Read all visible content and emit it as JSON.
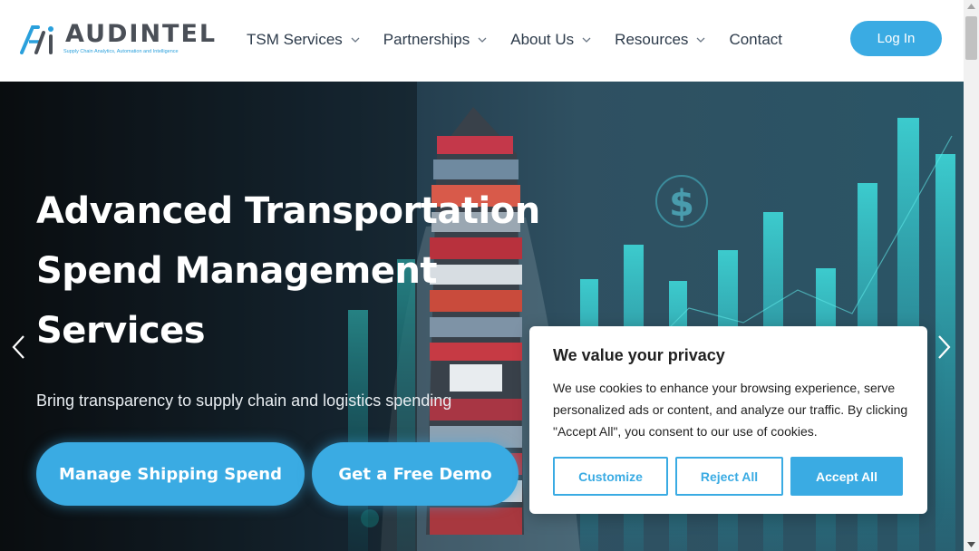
{
  "brand": {
    "name": "AUDINTEL",
    "tagline": "Supply Chain Analytics, Automation and Intelligence",
    "accent_color": "#3aabe3"
  },
  "nav": {
    "items": [
      {
        "label": "TSM Services",
        "has_dropdown": true
      },
      {
        "label": "Partnerships",
        "has_dropdown": true
      },
      {
        "label": "About Us",
        "has_dropdown": true
      },
      {
        "label": "Resources",
        "has_dropdown": true
      },
      {
        "label": "Contact",
        "has_dropdown": false
      }
    ],
    "login_label": "Log In"
  },
  "hero": {
    "title": "Advanced Transportation Spend Management Services",
    "subtitle": "Bring transparency to supply chain and logistics spending",
    "cta_primary": "Manage Shipping Spend",
    "cta_secondary": "Get a Free Demo",
    "dollar_symbol": "$"
  },
  "cookie": {
    "title": "We value your privacy",
    "text": "We use cookies to enhance your browsing experience, serve personalized ads or content, and analyze our traffic. By clicking \"Accept All\", you consent to our use of cookies.",
    "customize_label": "Customize",
    "reject_label": "Reject All",
    "accept_label": "Accept All"
  },
  "icons": {
    "chevron": "chevron-down-icon",
    "prev": "chevron-left-icon",
    "next": "chevron-right-icon"
  }
}
